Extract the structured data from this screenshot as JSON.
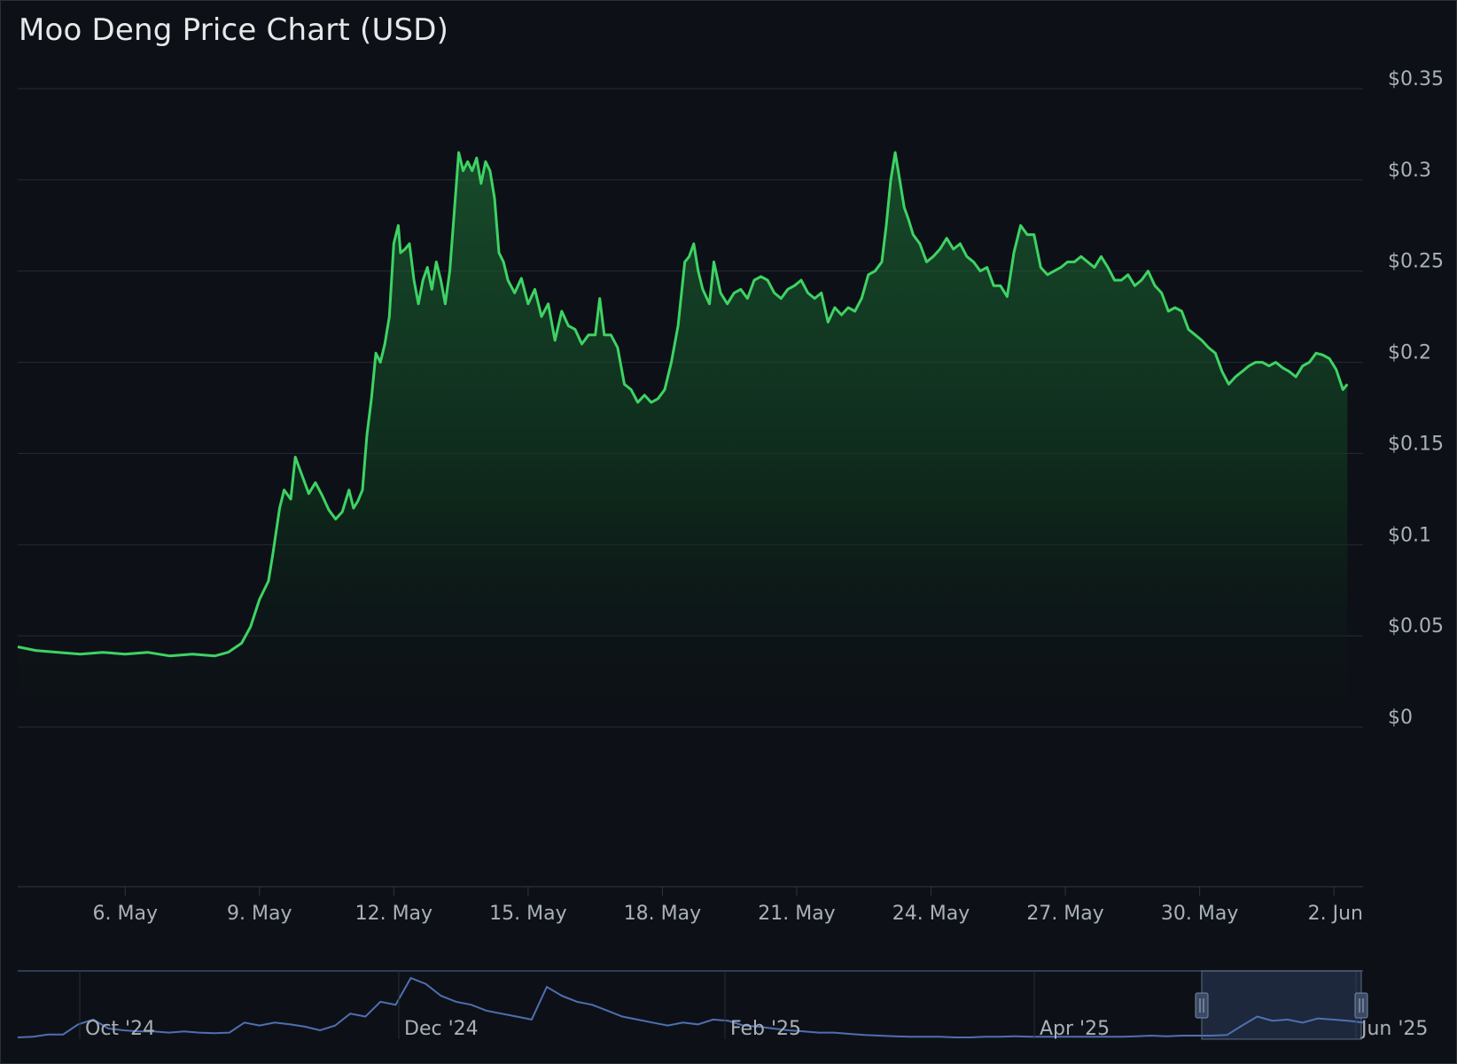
{
  "chart_data": {
    "title": "Moo Deng Price Chart (USD)",
    "type": "area",
    "currency_prefix": "$",
    "y_ticks": [
      "$0",
      "$0.05",
      "$0.1",
      "$0.15",
      "$0.2",
      "$0.25",
      "$0.3",
      "$0.35"
    ],
    "y_tick_values": [
      0,
      0.05,
      0.1,
      0.15,
      0.2,
      0.25,
      0.3,
      0.35
    ],
    "ylim": [
      0,
      0.35
    ],
    "x_ticks": [
      "6. May",
      "9. May",
      "12. May",
      "15. May",
      "18. May",
      "21. May",
      "24. May",
      "27. May",
      "30. May",
      "2. Jun"
    ],
    "x_tick_days": [
      6,
      9,
      12,
      15,
      18,
      21,
      24,
      27,
      30,
      33
    ],
    "xlim_days": [
      3.6,
      33.65
    ],
    "x_unit_note": "May 2025",
    "series": [
      {
        "color": "#3ed364",
        "points": [
          [
            3.6,
            0.044
          ],
          [
            4.0,
            0.042
          ],
          [
            4.5,
            0.041
          ],
          [
            5.0,
            0.04
          ],
          [
            5.5,
            0.041
          ],
          [
            6.0,
            0.04
          ],
          [
            6.5,
            0.041
          ],
          [
            7.0,
            0.039
          ],
          [
            7.5,
            0.04
          ],
          [
            8.0,
            0.039
          ],
          [
            8.3,
            0.041
          ],
          [
            8.6,
            0.046
          ],
          [
            8.8,
            0.055
          ],
          [
            9.0,
            0.07
          ],
          [
            9.2,
            0.08
          ],
          [
            9.3,
            0.095
          ],
          [
            9.45,
            0.12
          ],
          [
            9.55,
            0.13
          ],
          [
            9.7,
            0.125
          ],
          [
            9.8,
            0.148
          ],
          [
            9.95,
            0.138
          ],
          [
            10.1,
            0.128
          ],
          [
            10.25,
            0.134
          ],
          [
            10.4,
            0.127
          ],
          [
            10.55,
            0.119
          ],
          [
            10.7,
            0.114
          ],
          [
            10.85,
            0.118
          ],
          [
            11.0,
            0.13
          ],
          [
            11.1,
            0.12
          ],
          [
            11.2,
            0.124
          ],
          [
            11.3,
            0.13
          ],
          [
            11.4,
            0.16
          ],
          [
            11.5,
            0.18
          ],
          [
            11.6,
            0.205
          ],
          [
            11.7,
            0.2
          ],
          [
            11.8,
            0.21
          ],
          [
            11.9,
            0.225
          ],
          [
            12.0,
            0.265
          ],
          [
            12.1,
            0.275
          ],
          [
            12.15,
            0.26
          ],
          [
            12.25,
            0.262
          ],
          [
            12.35,
            0.265
          ],
          [
            12.45,
            0.245
          ],
          [
            12.55,
            0.232
          ],
          [
            12.65,
            0.245
          ],
          [
            12.75,
            0.252
          ],
          [
            12.85,
            0.24
          ],
          [
            12.95,
            0.255
          ],
          [
            13.05,
            0.245
          ],
          [
            13.15,
            0.232
          ],
          [
            13.25,
            0.25
          ],
          [
            13.35,
            0.282
          ],
          [
            13.45,
            0.315
          ],
          [
            13.55,
            0.305
          ],
          [
            13.65,
            0.31
          ],
          [
            13.75,
            0.305
          ],
          [
            13.85,
            0.312
          ],
          [
            13.95,
            0.298
          ],
          [
            14.05,
            0.31
          ],
          [
            14.15,
            0.305
          ],
          [
            14.25,
            0.29
          ],
          [
            14.35,
            0.26
          ],
          [
            14.45,
            0.255
          ],
          [
            14.55,
            0.245
          ],
          [
            14.7,
            0.238
          ],
          [
            14.85,
            0.246
          ],
          [
            15.0,
            0.232
          ],
          [
            15.15,
            0.24
          ],
          [
            15.3,
            0.225
          ],
          [
            15.45,
            0.232
          ],
          [
            15.6,
            0.212
          ],
          [
            15.75,
            0.228
          ],
          [
            15.9,
            0.22
          ],
          [
            16.05,
            0.218
          ],
          [
            16.2,
            0.21
          ],
          [
            16.35,
            0.215
          ],
          [
            16.5,
            0.215
          ],
          [
            16.6,
            0.235
          ],
          [
            16.7,
            0.215
          ],
          [
            16.85,
            0.215
          ],
          [
            17.0,
            0.208
          ],
          [
            17.15,
            0.188
          ],
          [
            17.3,
            0.185
          ],
          [
            17.45,
            0.178
          ],
          [
            17.6,
            0.182
          ],
          [
            17.75,
            0.178
          ],
          [
            17.9,
            0.18
          ],
          [
            18.05,
            0.185
          ],
          [
            18.2,
            0.2
          ],
          [
            18.35,
            0.22
          ],
          [
            18.5,
            0.255
          ],
          [
            18.6,
            0.258
          ],
          [
            18.7,
            0.265
          ],
          [
            18.8,
            0.25
          ],
          [
            18.9,
            0.24
          ],
          [
            19.05,
            0.232
          ],
          [
            19.15,
            0.255
          ],
          [
            19.3,
            0.238
          ],
          [
            19.45,
            0.232
          ],
          [
            19.6,
            0.238
          ],
          [
            19.75,
            0.24
          ],
          [
            19.9,
            0.235
          ],
          [
            20.05,
            0.245
          ],
          [
            20.2,
            0.247
          ],
          [
            20.35,
            0.245
          ],
          [
            20.5,
            0.238
          ],
          [
            20.65,
            0.235
          ],
          [
            20.8,
            0.24
          ],
          [
            20.95,
            0.242
          ],
          [
            21.1,
            0.245
          ],
          [
            21.25,
            0.238
          ],
          [
            21.4,
            0.235
          ],
          [
            21.55,
            0.238
          ],
          [
            21.7,
            0.222
          ],
          [
            21.85,
            0.23
          ],
          [
            22.0,
            0.226
          ],
          [
            22.15,
            0.23
          ],
          [
            22.3,
            0.228
          ],
          [
            22.45,
            0.235
          ],
          [
            22.6,
            0.248
          ],
          [
            22.75,
            0.25
          ],
          [
            22.9,
            0.255
          ],
          [
            23.0,
            0.275
          ],
          [
            23.1,
            0.3
          ],
          [
            23.2,
            0.315
          ],
          [
            23.3,
            0.3
          ],
          [
            23.4,
            0.285
          ],
          [
            23.5,
            0.278
          ],
          [
            23.6,
            0.27
          ],
          [
            23.75,
            0.265
          ],
          [
            23.9,
            0.255
          ],
          [
            24.05,
            0.258
          ],
          [
            24.2,
            0.262
          ],
          [
            24.35,
            0.268
          ],
          [
            24.5,
            0.262
          ],
          [
            24.65,
            0.265
          ],
          [
            24.8,
            0.258
          ],
          [
            24.95,
            0.255
          ],
          [
            25.1,
            0.25
          ],
          [
            25.25,
            0.252
          ],
          [
            25.4,
            0.242
          ],
          [
            25.55,
            0.242
          ],
          [
            25.7,
            0.236
          ],
          [
            25.85,
            0.26
          ],
          [
            26.0,
            0.275
          ],
          [
            26.15,
            0.27
          ],
          [
            26.3,
            0.27
          ],
          [
            26.45,
            0.252
          ],
          [
            26.6,
            0.248
          ],
          [
            26.75,
            0.25
          ],
          [
            26.9,
            0.252
          ],
          [
            27.05,
            0.255
          ],
          [
            27.2,
            0.255
          ],
          [
            27.35,
            0.258
          ],
          [
            27.5,
            0.255
          ],
          [
            27.65,
            0.252
          ],
          [
            27.8,
            0.258
          ],
          [
            27.95,
            0.252
          ],
          [
            28.1,
            0.245
          ],
          [
            28.25,
            0.245
          ],
          [
            28.4,
            0.248
          ],
          [
            28.55,
            0.242
          ],
          [
            28.7,
            0.245
          ],
          [
            28.85,
            0.25
          ],
          [
            29.0,
            0.242
          ],
          [
            29.15,
            0.238
          ],
          [
            29.3,
            0.228
          ],
          [
            29.45,
            0.23
          ],
          [
            29.6,
            0.228
          ],
          [
            29.75,
            0.218
          ],
          [
            29.9,
            0.215
          ],
          [
            30.05,
            0.212
          ],
          [
            30.2,
            0.208
          ],
          [
            30.35,
            0.205
          ],
          [
            30.5,
            0.195
          ],
          [
            30.65,
            0.188
          ],
          [
            30.8,
            0.192
          ],
          [
            30.95,
            0.195
          ],
          [
            31.1,
            0.198
          ],
          [
            31.25,
            0.2
          ],
          [
            31.4,
            0.2
          ],
          [
            31.55,
            0.198
          ],
          [
            31.7,
            0.2
          ],
          [
            31.85,
            0.197
          ],
          [
            32.0,
            0.195
          ],
          [
            32.15,
            0.192
          ],
          [
            32.3,
            0.198
          ],
          [
            32.45,
            0.2
          ],
          [
            32.6,
            0.205
          ],
          [
            32.75,
            0.204
          ],
          [
            32.9,
            0.202
          ],
          [
            33.05,
            0.196
          ],
          [
            33.2,
            0.185
          ],
          [
            33.3,
            0.188
          ]
        ]
      }
    ],
    "navigator": {
      "labels": [
        "Oct '24",
        "Dec '24",
        "Feb '25",
        "Apr '25",
        "Jun '25"
      ],
      "series": [
        0.0,
        0.01,
        0.05,
        0.05,
        0.22,
        0.3,
        0.15,
        0.12,
        0.1,
        0.1,
        0.08,
        0.1,
        0.08,
        0.07,
        0.08,
        0.25,
        0.2,
        0.25,
        0.22,
        0.18,
        0.12,
        0.2,
        0.4,
        0.35,
        0.6,
        0.55,
        1.0,
        0.9,
        0.7,
        0.6,
        0.55,
        0.45,
        0.4,
        0.35,
        0.3,
        0.85,
        0.7,
        0.6,
        0.55,
        0.45,
        0.35,
        0.3,
        0.25,
        0.2,
        0.25,
        0.22,
        0.3,
        0.28,
        0.2,
        0.18,
        0.15,
        0.12,
        0.1,
        0.08,
        0.08,
        0.06,
        0.04,
        0.03,
        0.02,
        0.01,
        0.01,
        0.01,
        0.0,
        0.0,
        0.01,
        0.01,
        0.02,
        0.01,
        0.01,
        0.01,
        0.01,
        0.01,
        0.01,
        0.01,
        0.02,
        0.03,
        0.02,
        0.03,
        0.03,
        0.03,
        0.04,
        0.2,
        0.35,
        0.28,
        0.3,
        0.25,
        0.32,
        0.3,
        0.28,
        0.25
      ]
    }
  }
}
